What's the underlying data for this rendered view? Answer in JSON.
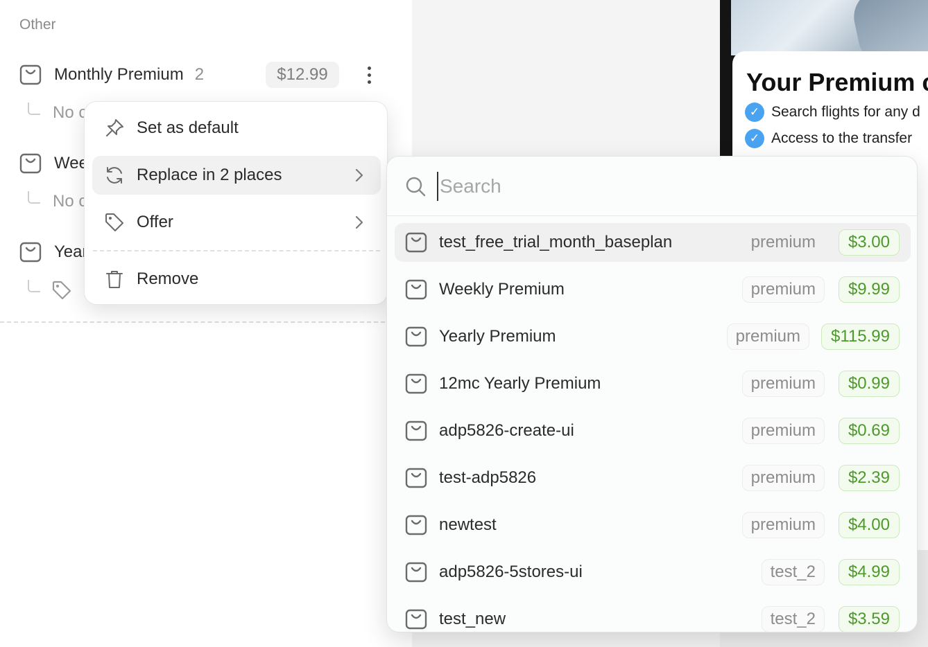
{
  "left_panel": {
    "section_label": "Other",
    "products": [
      {
        "name": "Monthly Premium",
        "count": "2",
        "price": "$12.99",
        "sub": "No c"
      },
      {
        "name": "Wee",
        "sub": "No c"
      },
      {
        "name": "Year"
      }
    ]
  },
  "context_menu": {
    "items": [
      {
        "label": "Set as default",
        "icon": "pin-icon"
      },
      {
        "label": "Replace in 2 places",
        "icon": "refresh-icon",
        "has_submenu": true
      },
      {
        "label": "Offer",
        "icon": "tag-icon",
        "has_submenu": true
      },
      {
        "label": "Remove",
        "icon": "trash-icon"
      }
    ]
  },
  "search": {
    "placeholder": "Search",
    "value": ""
  },
  "results": [
    {
      "name": "test_free_trial_month_baseplan",
      "tag": "premium",
      "price": "$3.00"
    },
    {
      "name": "Weekly Premium",
      "tag": "premium",
      "price": "$9.99"
    },
    {
      "name": "Yearly Premium",
      "tag": "premium",
      "price": "$115.99"
    },
    {
      "name": "12mc Yearly Premium",
      "tag": "premium",
      "price": "$0.99"
    },
    {
      "name": "adp5826-create-ui",
      "tag": "premium",
      "price": "$0.69"
    },
    {
      "name": "test-adp5826",
      "tag": "premium",
      "price": "$2.39"
    },
    {
      "name": "newtest",
      "tag": "premium",
      "price": "$4.00"
    },
    {
      "name": "adp5826-5stores-ui",
      "tag": "test_2",
      "price": "$4.99"
    },
    {
      "name": "test_new",
      "tag": "test_2",
      "price": "$3.59"
    }
  ],
  "preview": {
    "title": "Your Premium c",
    "features": [
      "Search flights for any d",
      "Access to the transfer"
    ]
  },
  "colors": {
    "price_green": "#4c9a2a",
    "check_blue": "#4aa3f0"
  }
}
